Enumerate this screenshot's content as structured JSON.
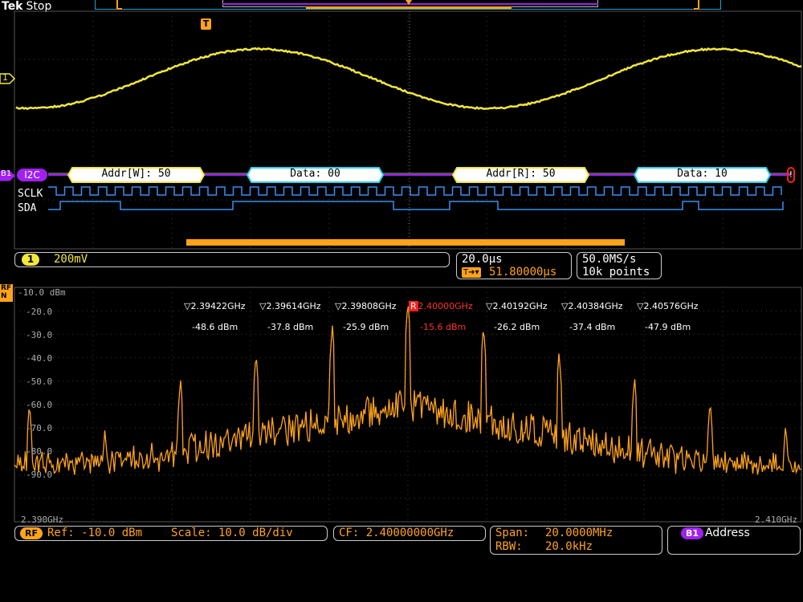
{
  "brand": {
    "name": "Tek",
    "status": "Stop"
  },
  "colors": {
    "ch1": "#f2e73c",
    "rf": "#ffa31a",
    "bus": "#a020f0",
    "cyan": "#27d3f0",
    "sclk": "#3a8df0",
    "grid": "#555555",
    "red": "#ff2020"
  },
  "markers": {
    "trigger": "T",
    "ch1": "1",
    "bus": "B1",
    "rf": "RF\nN"
  },
  "bus": {
    "label": "I2C",
    "packets": [
      {
        "label": "Addr[W]: 50",
        "kind": "addr"
      },
      {
        "label": "Data: 00",
        "kind": "data"
      },
      {
        "label": "Addr[R]: 50",
        "kind": "addr"
      },
      {
        "label": "Data: 10",
        "kind": "data"
      }
    ],
    "signals": [
      "SCLK",
      "SDA"
    ]
  },
  "channel1": {
    "badge": "1",
    "scale": "200mV"
  },
  "timebase": {
    "per_div": "20.0µs",
    "trigger_pos": "51.80000µs",
    "trigger_glyph": "T➔▾"
  },
  "acquisition": {
    "rate": "50.0MS/s",
    "points": "10k points"
  },
  "spectrum": {
    "yticks": [
      "-10.0 dBm",
      "-20.0",
      "-30.0",
      "-40.0",
      "-50.0",
      "-60.0",
      "-70.0",
      "-80.0",
      "-90.0"
    ],
    "x_start": "2.390GHz",
    "x_end": "2.410GHz",
    "markers": [
      {
        "symbol": "▽",
        "freq": "2.39422GHz",
        "level": "-48.6 dBm",
        "ref": false
      },
      {
        "symbol": "▽",
        "freq": "2.39614GHz",
        "level": "-37.8 dBm",
        "ref": false
      },
      {
        "symbol": "▽",
        "freq": "2.39808GHz",
        "level": "-25.9 dBm",
        "ref": false
      },
      {
        "symbol": "R",
        "freq": "2.40000GHz",
        "level": "-15.6 dBm",
        "ref": true
      },
      {
        "symbol": "▽",
        "freq": "2.40192GHz",
        "level": "-26.2 dBm",
        "ref": false
      },
      {
        "symbol": "▽",
        "freq": "2.40384GHz",
        "level": "-37.4 dBm",
        "ref": false
      },
      {
        "symbol": "▽",
        "freq": "2.40576GHz",
        "level": "-47.9 dBm",
        "ref": false
      }
    ]
  },
  "rf_status": {
    "badge": "RF",
    "ref": "Ref: -10.0 dBm",
    "scale": "Scale: 10.0 dB/div",
    "cf": "CF:  2.40000000GHz",
    "span_label": "Span:",
    "span": "20.0000MHz",
    "rbw_label": "RBW:",
    "rbw": "20.0kHz"
  },
  "bus_status": {
    "badge": "B1",
    "label": "Address"
  }
}
